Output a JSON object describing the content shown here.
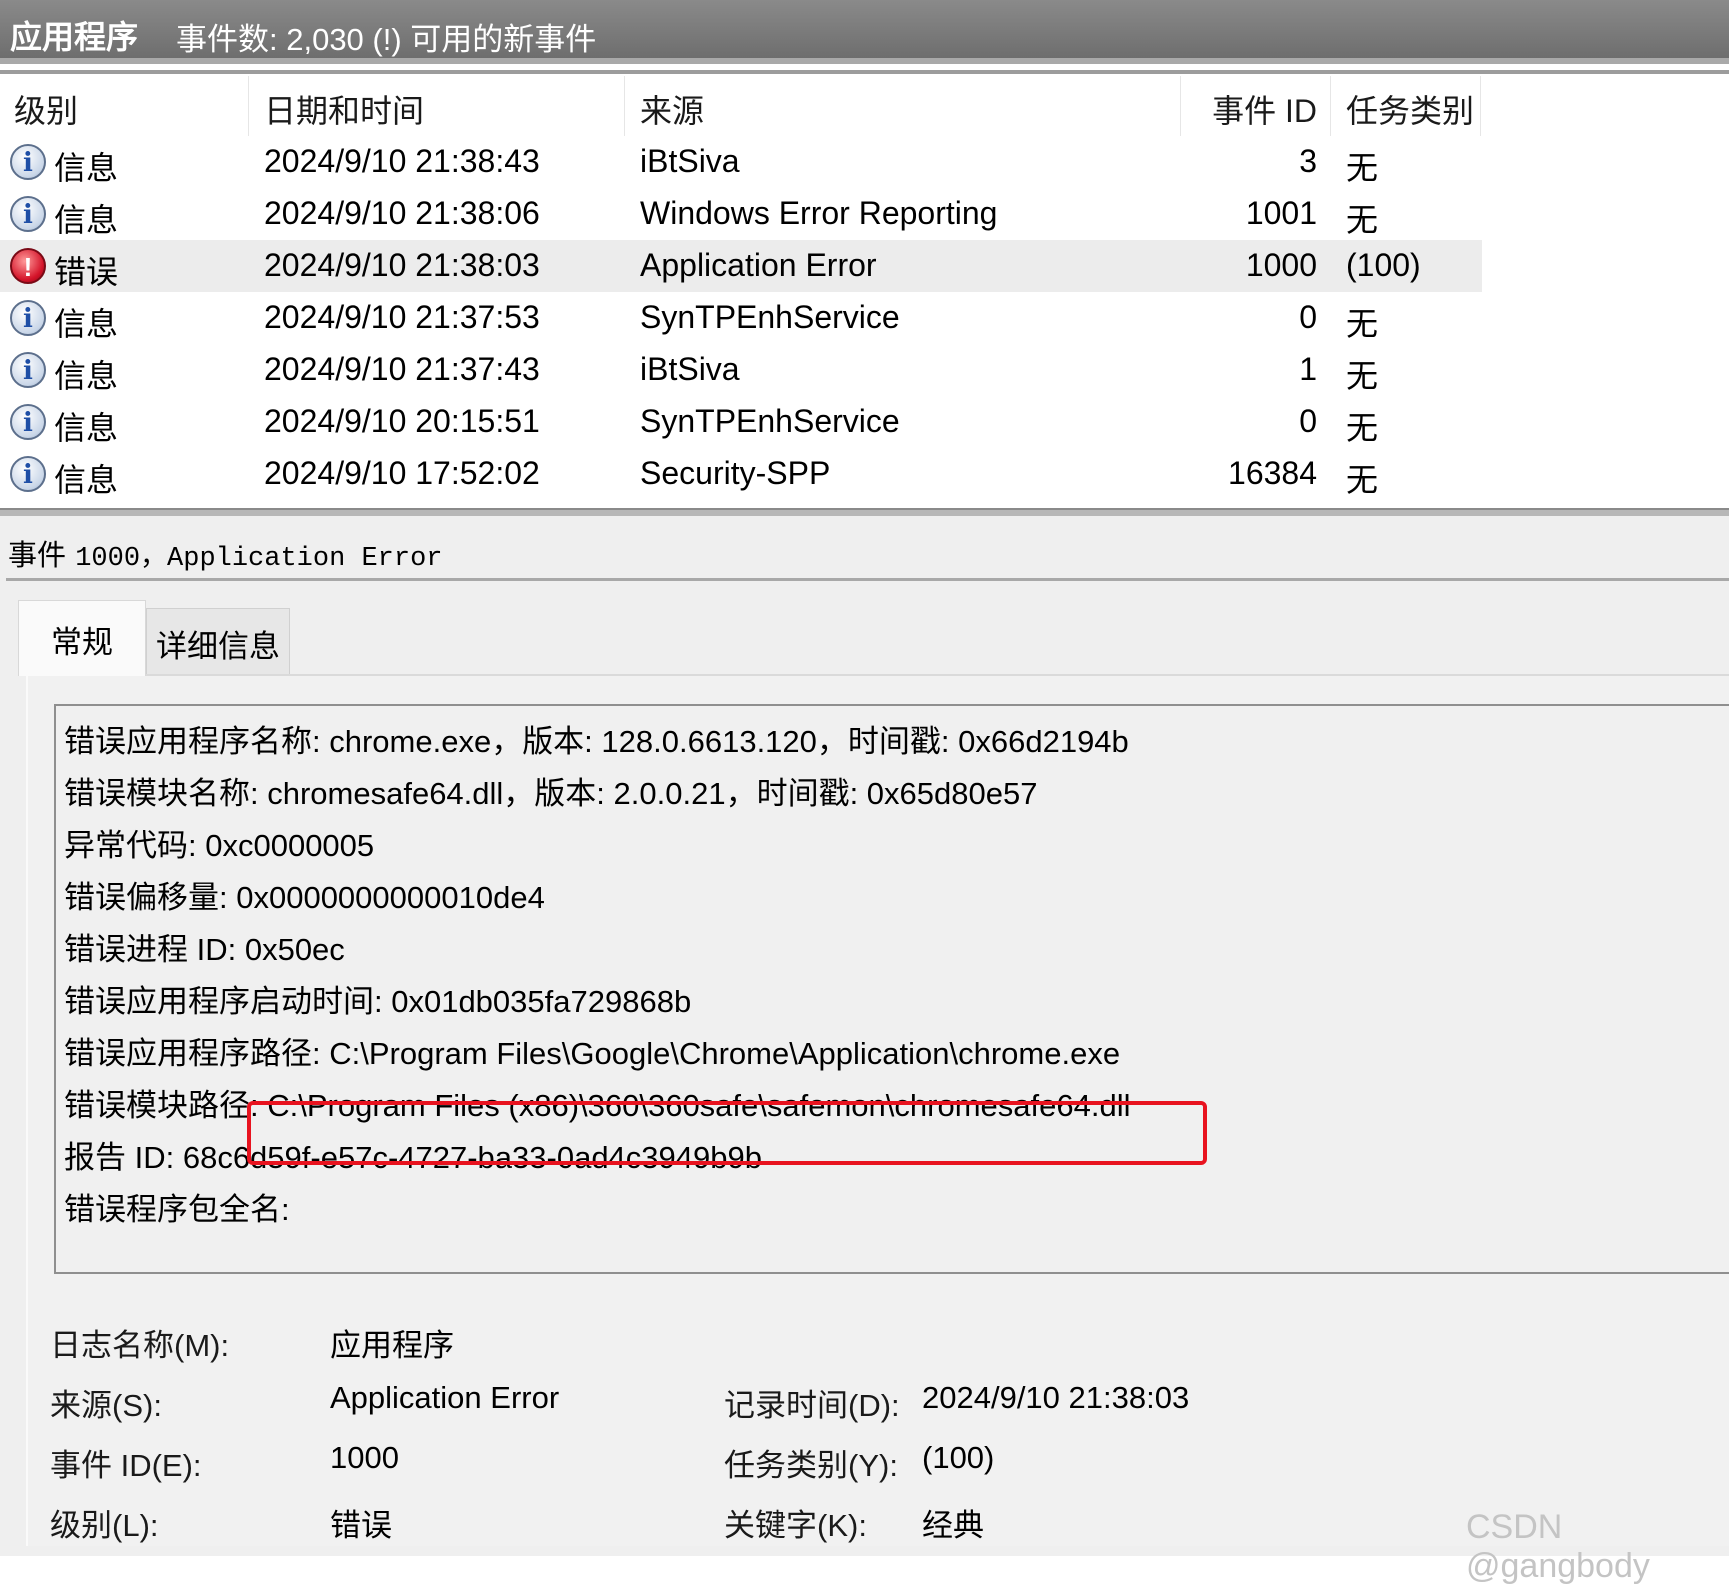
{
  "header": {
    "title": "应用程序",
    "event_count": "事件数: 2,030 (!) 可用的新事件"
  },
  "columns": [
    "级别",
    "日期和时间",
    "来源",
    "事件 ID",
    "任务类别"
  ],
  "rows": [
    {
      "icon": "info-icon",
      "level": "信息",
      "datetime": "2024/9/10 21:38:43",
      "source": "iBtSiva",
      "event_id": "3",
      "task": "无"
    },
    {
      "icon": "info-icon",
      "level": "信息",
      "datetime": "2024/9/10 21:38:06",
      "source": "Windows Error Reporting",
      "event_id": "1001",
      "task": "无"
    },
    {
      "icon": "error-icon",
      "level": "错误",
      "datetime": "2024/9/10 21:38:03",
      "source": "Application Error",
      "event_id": "1000",
      "task": "(100)",
      "selected": true
    },
    {
      "icon": "info-icon",
      "level": "信息",
      "datetime": "2024/9/10 21:37:53",
      "source": "SynTPEnhService",
      "event_id": "0",
      "task": "无"
    },
    {
      "icon": "info-icon",
      "level": "信息",
      "datetime": "2024/9/10 21:37:43",
      "source": "iBtSiva",
      "event_id": "1",
      "task": "无"
    },
    {
      "icon": "info-icon",
      "level": "信息",
      "datetime": "2024/9/10 20:15:51",
      "source": "SynTPEnhService",
      "event_id": "0",
      "task": "无"
    },
    {
      "icon": "info-icon",
      "level": "信息",
      "datetime": "2024/9/10 17:52:02",
      "source": "Security-SPP",
      "event_id": "16384",
      "task": "无"
    }
  ],
  "detail": {
    "title_prefix": "事件",
    "title_rest": "1000，Application Error",
    "tabs": [
      "常规",
      "详细信息"
    ],
    "description": [
      "错误应用程序名称: chrome.exe，版本: 128.0.6613.120，时间戳: 0x66d2194b",
      "错误模块名称: chromesafe64.dll，版本: 2.0.0.21，时间戳: 0x65d80e57",
      "异常代码: 0xc0000005",
      "错误偏移量: 0x0000000000010de4",
      "错误进程 ID: 0x50ec",
      "错误应用程序启动时间: 0x01db035fa729868b",
      "错误应用程序路径: C:\\Program Files\\Google\\Chrome\\Application\\chrome.exe",
      "错误模块路径: C:\\Program Files (x86)\\360\\360safe\\safemon\\chromesafe64.dll",
      "报告 ID: 68c6d59f-e57c-4727-ba33-0ad4c3949b9b",
      "错误程序包全名:"
    ],
    "highlight_color": "#e8131f",
    "fields": {
      "log_name_label": "日志名称(M):",
      "log_name": "应用程序",
      "source_label": "来源(S):",
      "source": "Application Error",
      "logged_label": "记录时间(D):",
      "logged": "2024/9/10 21:38:03",
      "event_id_label": "事件 ID(E):",
      "event_id": "1000",
      "task_label": "任务类别(Y):",
      "task": "(100)",
      "level_label": "级别(L):",
      "level": "错误",
      "keywords_label": "关键字(K):",
      "keywords": "经典"
    }
  },
  "watermark": "CSDN @gangbody"
}
